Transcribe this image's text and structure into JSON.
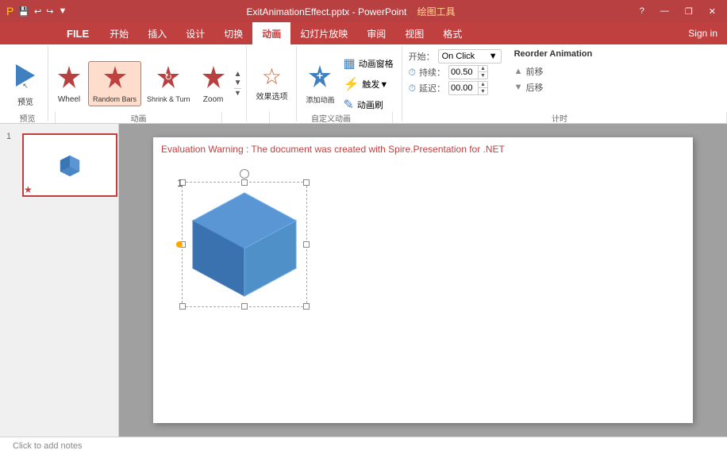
{
  "title_bar": {
    "filename": "ExitAnimationEffect.pptx - PowerPoint",
    "drawing_tools": "绘图工具",
    "help": "?",
    "minimize": "—",
    "restore": "❐",
    "close": "✕",
    "quick_save": "💾",
    "undo": "↩",
    "redo": "↪"
  },
  "tabs": [
    {
      "label": "FILE",
      "active": false,
      "is_file": true
    },
    {
      "label": "开始",
      "active": false
    },
    {
      "label": "插入",
      "active": false
    },
    {
      "label": "设计",
      "active": false
    },
    {
      "label": "切换",
      "active": false
    },
    {
      "label": "动画",
      "active": true
    },
    {
      "label": "幻灯片放映",
      "active": false
    },
    {
      "label": "审阅",
      "active": false
    },
    {
      "label": "视图",
      "active": false
    },
    {
      "label": "格式",
      "active": false
    }
  ],
  "sign_in": "Sign in",
  "ribbon": {
    "preview_btn": "预览",
    "preview_label": "预览",
    "wheel_label": "Wheel",
    "random_bars_label": "Random Bars",
    "shrink_turn_label": "Shrink & Turn",
    "zoom_label": "Zoom",
    "effects_label": "效果选项",
    "add_animation_label": "添加动画",
    "animation_panel_label": "动画窗格",
    "trigger_label": "触发▼",
    "animation_brush_label": "动画刷",
    "start_label": "开始：",
    "duration_label": "持续：",
    "delay_label": "延迟：",
    "on_click_value": "On Click",
    "duration_value": "00.50",
    "delay_value": "00.00",
    "reorder_title": "Reorder Animation",
    "move_earlier": "前移",
    "move_later": "后移",
    "group_animation": "动画",
    "group_custom_animation": "自定义动画",
    "group_timing": "计时"
  },
  "slide": {
    "number": "1",
    "star": "★",
    "eval_warning": "Evaluation Warning : The document was created with  Spire.Presentation for .NET",
    "cube_number": "1",
    "notes_placeholder": "Click to add notes"
  }
}
